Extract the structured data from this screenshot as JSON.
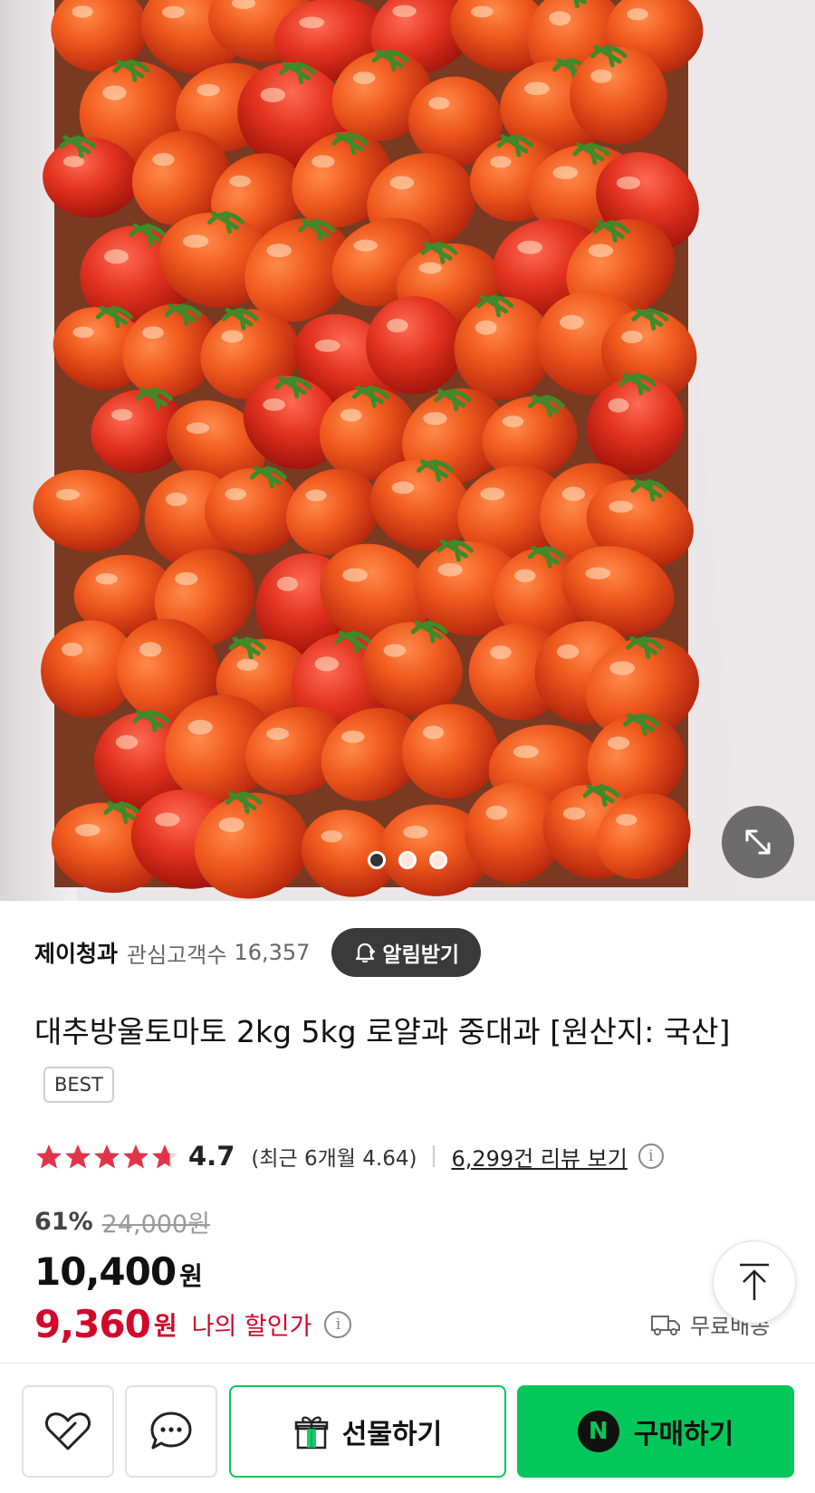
{
  "store": {
    "name": "제이청과",
    "watchers_label": "관심고객수",
    "watchers_count": "16,357",
    "notify_label": "알림받기"
  },
  "product": {
    "title": "대추방울토마토 2kg 5kg 로얄과 중대과 [원산지: 국산]",
    "badge": "BEST",
    "image_pages": 3,
    "current_image": 1
  },
  "rating": {
    "score": "4.7",
    "stars_value": 4.7,
    "recent": "(최근 6개월 4.64)",
    "review_link": "6,299건 리뷰 보기"
  },
  "price": {
    "discount_rate": "61%",
    "original": "24,000원",
    "sale": "10,400",
    "currency": "원",
    "my_price": "9,360",
    "my_price_label": "나의 할인가",
    "shipping": "무료배송"
  },
  "bottom_bar": {
    "gift_label": "선물하기",
    "buy_label": "구매하기",
    "buy_badge": "N"
  },
  "colors": {
    "accent_green": "#03c75a",
    "discount_red": "#d3072a",
    "star_red": "#e1344a"
  }
}
